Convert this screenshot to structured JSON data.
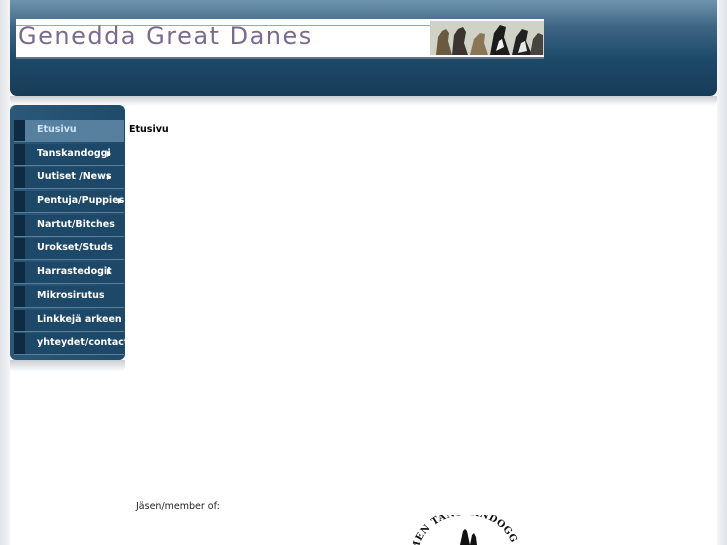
{
  "header": {
    "site_title": "Genedda Great Danes"
  },
  "sidebar": {
    "items": [
      {
        "label": "Etusivu",
        "active": true,
        "has_submenu": false
      },
      {
        "label": "Tanskandoggi",
        "active": false,
        "has_submenu": true
      },
      {
        "label": "Uutiset /News",
        "active": false,
        "has_submenu": true
      },
      {
        "label": "Pentuja/Puppies",
        "active": false,
        "has_submenu": true
      },
      {
        "label": "Nartut/Bitches",
        "active": false,
        "has_submenu": false
      },
      {
        "label": "Urokset/Studs",
        "active": false,
        "has_submenu": false
      },
      {
        "label": "Harrastedogit",
        "active": false,
        "has_submenu": true
      },
      {
        "label": "Mikrosirutus",
        "active": false,
        "has_submenu": false
      },
      {
        "label": "Linkkejä arkeen",
        "active": false,
        "has_submenu": false
      },
      {
        "label": "yhteydet/contact",
        "active": false,
        "has_submenu": false
      }
    ]
  },
  "main": {
    "heading": "Etusivu",
    "member_label": "Jäsen/member of:",
    "logo_text": "MEN TANSKANDOGG"
  },
  "colors": {
    "header_dark": "#173c57",
    "menu_bg": "#1d4868",
    "menu_active_bg": "#57809f",
    "active_text": "#cbe5f8"
  }
}
